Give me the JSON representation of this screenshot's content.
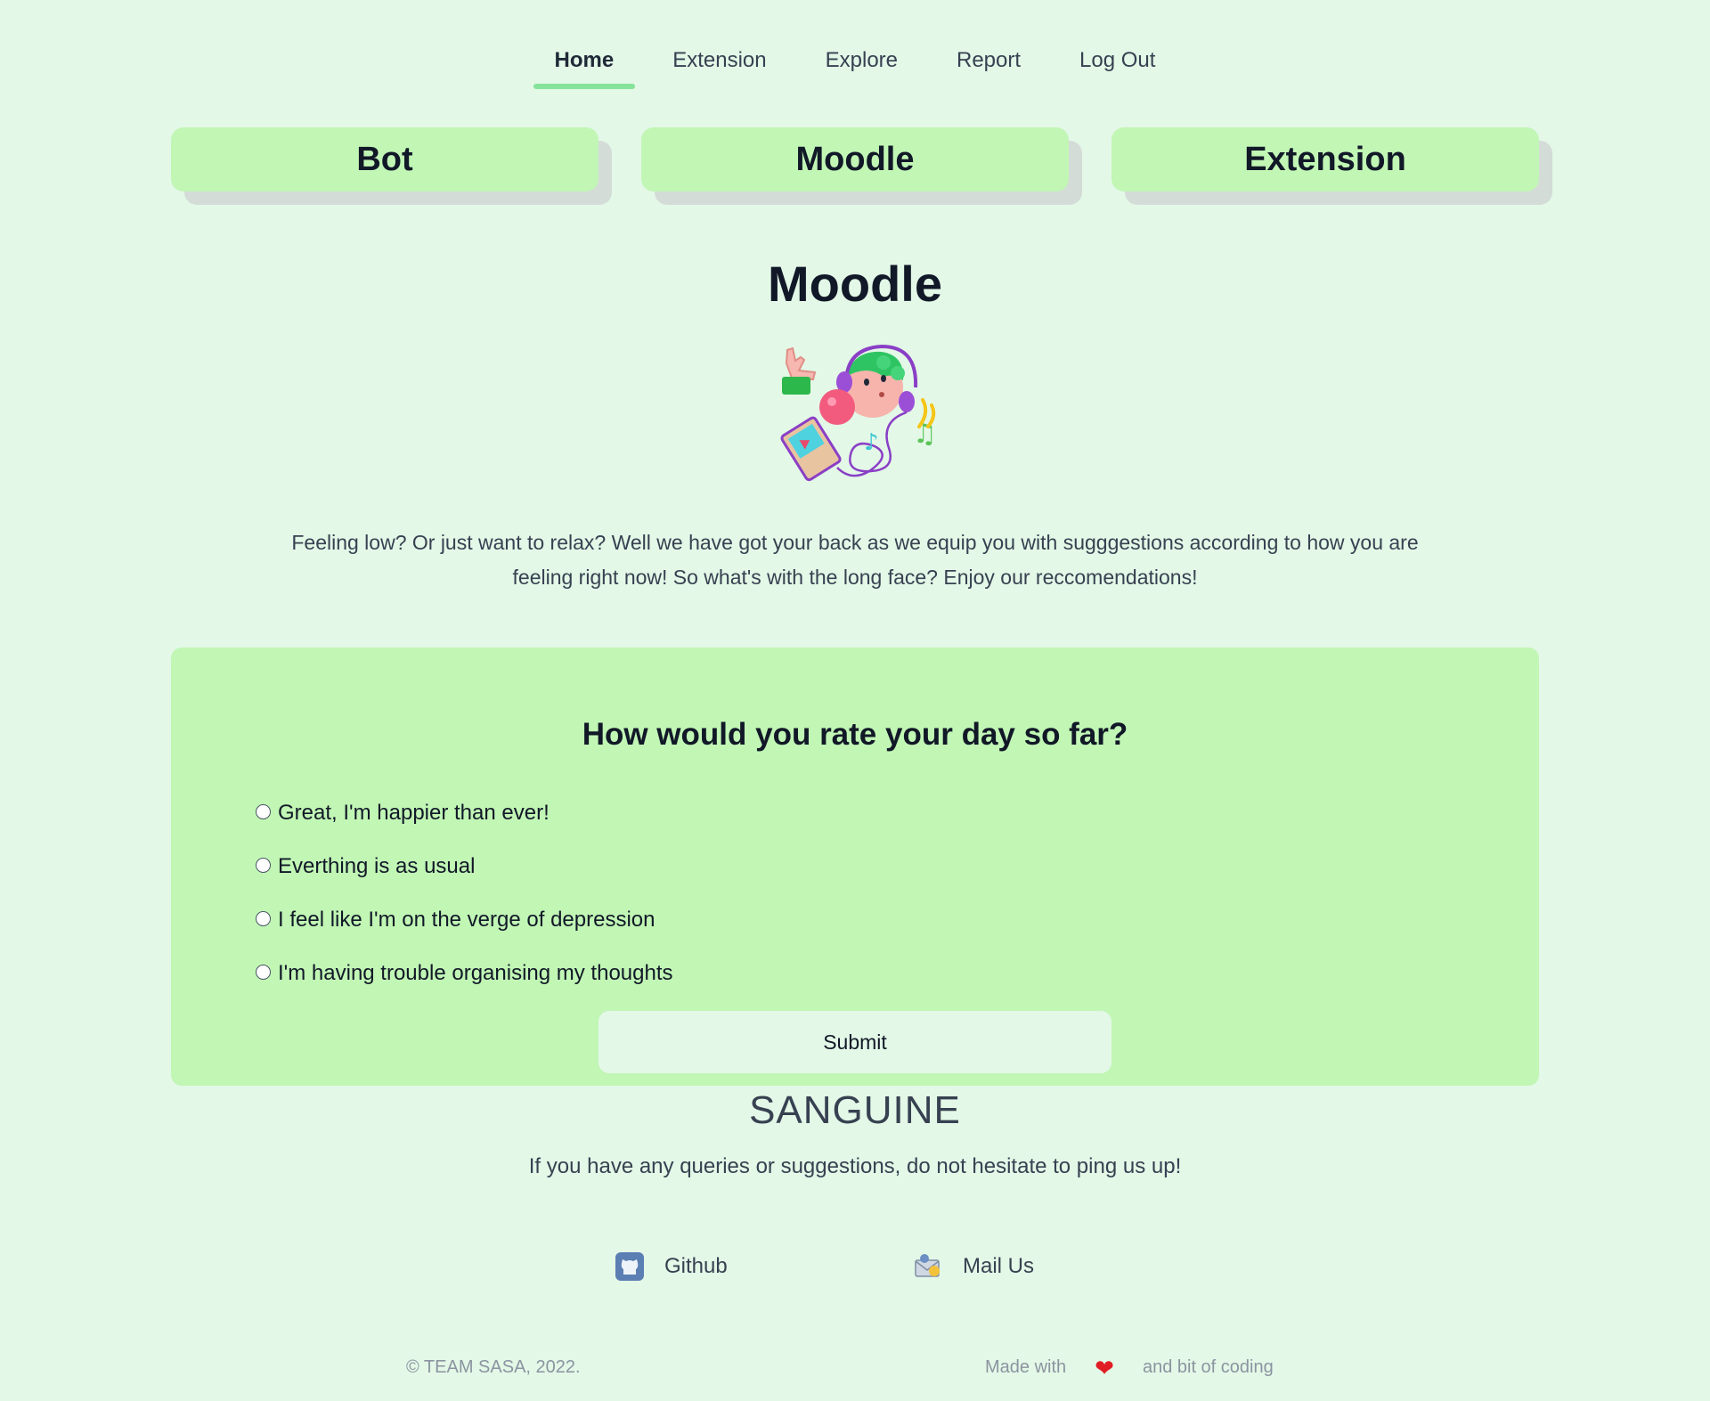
{
  "nav": {
    "items": [
      {
        "label": "Home",
        "active": true
      },
      {
        "label": "Extension",
        "active": false
      },
      {
        "label": "Explore",
        "active": false
      },
      {
        "label": "Report",
        "active": false
      },
      {
        "label": "Log Out",
        "active": false
      }
    ]
  },
  "cards": [
    {
      "label": "Bot"
    },
    {
      "label": "Moodle"
    },
    {
      "label": "Extension"
    }
  ],
  "page": {
    "title": "Moodle",
    "hero_icon": "girl-listening-music-illustration",
    "intro": "Feeling low? Or just want to relax? Well we have got your back as we equip you with sugggestions according to how you are feeling right now! So what's with the long face? Enjoy our reccomendations!"
  },
  "survey": {
    "question": "How would you rate your day so far?",
    "options": [
      "Great, I'm happier than ever!",
      "Everthing is as usual",
      "I feel like I'm on the verge of depression",
      "I'm having trouble organising my thoughts"
    ],
    "submit_label": "Submit"
  },
  "footer": {
    "brand": "SANGUINE",
    "contact_text": "If you have any queries or suggestions, do not hesitate to ping us up!",
    "github_label": "Github",
    "github_icon": "github-icon",
    "mail_label": "Mail Us",
    "mail_icon": "mail-icon",
    "copyright": "© TEAM SASA, 2022.",
    "made_with": "Made with",
    "heart": "❤",
    "coding": "and bit of coding"
  },
  "colors": {
    "background": "#e3f8e7",
    "accent_green": "#c1f6b5",
    "nav_underline": "#86e39a",
    "heart": "#e11d24"
  }
}
